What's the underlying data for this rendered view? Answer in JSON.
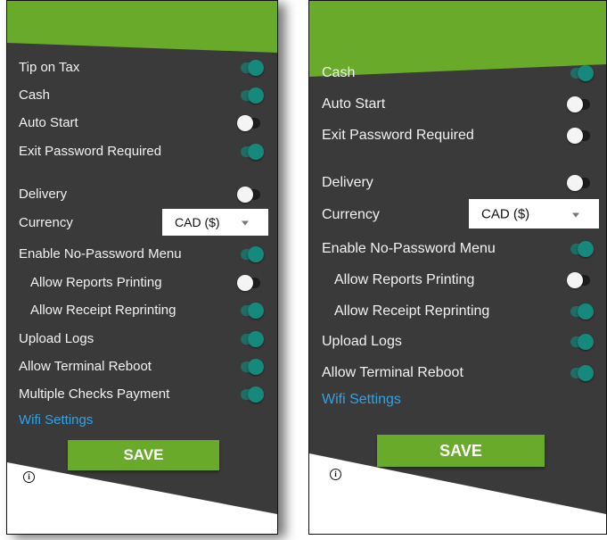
{
  "left_panel": {
    "rows": [
      {
        "label": "Tip on Tax",
        "toggle": "on"
      },
      {
        "label": "Cash",
        "toggle": "on"
      },
      {
        "label": "Auto Start",
        "toggle": "off"
      },
      {
        "label": "Exit Password Required",
        "toggle": "on"
      },
      {
        "label": "Delivery",
        "toggle": "off"
      },
      {
        "label": "Enable No-Password Menu",
        "toggle": "on"
      },
      {
        "label": "Allow Reports Printing",
        "toggle": "off"
      },
      {
        "label": "Allow Receipt Reprinting",
        "toggle": "on"
      },
      {
        "label": "Upload Logs",
        "toggle": "on"
      },
      {
        "label": "Allow Terminal Reboot",
        "toggle": "on"
      },
      {
        "label": "Multiple Checks Payment",
        "toggle": "on"
      }
    ],
    "currency": {
      "label": "Currency",
      "value": "CAD ($)"
    },
    "wifi_link": "Wifi Settings",
    "save_label": "SAVE",
    "info_icon": "info-icon"
  },
  "right_panel": {
    "rows": [
      {
        "label": "Cash",
        "toggle": "on"
      },
      {
        "label": "Auto Start",
        "toggle": "off"
      },
      {
        "label": "Exit Password Required",
        "toggle": "off"
      },
      {
        "label": "Delivery",
        "toggle": "off"
      },
      {
        "label": "Enable No-Password Menu",
        "toggle": "on"
      },
      {
        "label": "Allow Reports Printing",
        "toggle": "off"
      },
      {
        "label": "Allow Receipt Reprinting",
        "toggle": "on"
      },
      {
        "label": "Upload Logs",
        "toggle": "on"
      },
      {
        "label": "Allow Terminal Reboot",
        "toggle": "on"
      }
    ],
    "currency": {
      "label": "Currency",
      "value": "CAD ($)"
    },
    "wifi_link": "Wifi Settings",
    "save_label": "SAVE",
    "info_icon": "info-icon"
  },
  "colors": {
    "header_green": "#6aaa2a",
    "panel_dark": "#3a3a3a",
    "toggle_on": "#16897c",
    "link_blue": "#2fa3e8"
  }
}
